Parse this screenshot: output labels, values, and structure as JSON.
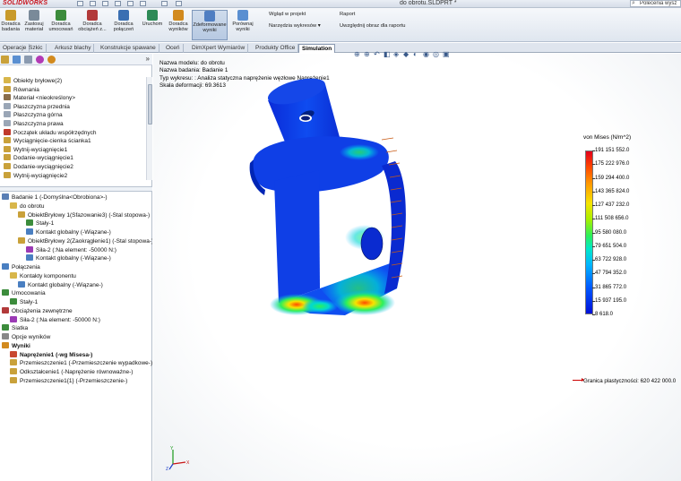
{
  "titlebar": {
    "logo": "SOLIDWORKS",
    "document_title": "do obrotu.SLDPRT *",
    "search_placeholder": "Polecenia wysz"
  },
  "ribbon": {
    "buttons": [
      {
        "label1": "Doradca",
        "label2": "badania",
        "color": "#c89a2a"
      },
      {
        "label1": "Zastosuj",
        "label2": "materiał",
        "color": "#7a8a99"
      },
      {
        "label1": "Doradca",
        "label2": "umocowań",
        "color": "#3c8c3c"
      },
      {
        "label1": "Doradca",
        "label2": "obciążeń z...",
        "color": "#b23a3a"
      },
      {
        "label1": "Doradca",
        "label2": "połączeń",
        "color": "#3a6fb2"
      },
      {
        "label1": "Uruchom",
        "label2": "",
        "color": "#2e8b57"
      },
      {
        "label1": "Doradca",
        "label2": "wyników",
        "color": "#d28a1e"
      },
      {
        "label1": "Zdeformowane",
        "label2": "wyniki",
        "color": "#4f7ec2"
      },
      {
        "label1": "Porównaj",
        "label2": "wyniki",
        "color": "#5a8fd1"
      }
    ],
    "small_items": [
      {
        "label": "Wgląd w projekt",
        "color": "#4a7fc1"
      },
      {
        "label": "Narzędzia wykresów",
        "color": "#c9472f"
      },
      {
        "label": "Raport",
        "color": "#2f6db5"
      },
      {
        "label": "Uwzględnij obraz dla raportu",
        "color": "#3a8a4a"
      }
    ]
  },
  "tabs": [
    {
      "label": "Operacje",
      "active": false
    },
    {
      "label": "Szkic",
      "active": false
    },
    {
      "label": "Arkusz blachy",
      "active": false
    },
    {
      "label": "Konstrukcje spawane",
      "active": false
    },
    {
      "label": "Oceń",
      "active": false
    },
    {
      "label": "DimXpert Wymiarów",
      "active": false
    },
    {
      "label": "Produkty Office",
      "active": false
    },
    {
      "label": "Simulation",
      "active": true
    }
  ],
  "feature_tree": {
    "items": [
      {
        "label": "Obiekty bryłowe(2)",
        "icon": "folder-icon",
        "color": "#d8b64a"
      },
      {
        "label": "Równania",
        "icon": "equation-icon",
        "color": "#c9a13a"
      },
      {
        "label": "Materiał <nieokreślony>",
        "icon": "material-icon",
        "color": "#8a6e4a"
      },
      {
        "label": "Płaszczyzna przednia",
        "icon": "plane-icon",
        "color": "#9aa6b6"
      },
      {
        "label": "Płaszczyzna górna",
        "icon": "plane-icon",
        "color": "#9aa6b6"
      },
      {
        "label": "Płaszczyzna prawa",
        "icon": "plane-icon",
        "color": "#9aa6b6"
      },
      {
        "label": "Początek układu współrzędnych",
        "icon": "origin-icon",
        "color": "#c0392b"
      },
      {
        "label": "Wyciągnięcie-cienka ścianka1",
        "icon": "extrude-icon",
        "color": "#c9a13a"
      },
      {
        "label": "Wytnij-wyciągnięcie1",
        "icon": "cut-icon",
        "color": "#c9a13a"
      },
      {
        "label": "Dodanie-wyciągnięcie1",
        "icon": "extrude-icon",
        "color": "#c9a13a"
      },
      {
        "label": "Dodanie-wyciągnięcie2",
        "icon": "extrude-icon",
        "color": "#c9a13a"
      },
      {
        "label": "Wytnij-wyciągnięcie2",
        "icon": "cut-icon",
        "color": "#c9a13a"
      }
    ]
  },
  "study_tree": {
    "items": [
      {
        "label": "Badanie 1 (-Domyślna<Obrobiona>-)",
        "indent": 0,
        "icon": "study-icon",
        "color": "#5a7fb5",
        "bold": false
      },
      {
        "label": "do obrotu",
        "indent": 1,
        "icon": "part-icon",
        "color": "#d8b64a",
        "bold": false
      },
      {
        "label": "ObiektBryłowy 1(Sfazowanie3) (-Stal stopowa-)",
        "indent": 2,
        "icon": "solid-body-icon",
        "color": "#c9a13a",
        "bold": false
      },
      {
        "label": "Stały-1",
        "indent": 3,
        "icon": "fixture-icon",
        "color": "#3c8c3c",
        "bold": false
      },
      {
        "label": "Kontakt globalny (-Wiązane-)",
        "indent": 3,
        "icon": "contact-icon",
        "color": "#4a7fc1",
        "bold": false
      },
      {
        "label": "ObiektBryłowy 2(Zaokrąglenie1) (-Stal stopowa-)",
        "indent": 2,
        "icon": "solid-body-icon",
        "color": "#c9a13a",
        "bold": false
      },
      {
        "label": "Siła-2 (:Na element: -50000 N:)",
        "indent": 3,
        "icon": "force-icon",
        "color": "#9b3ab5",
        "bold": false
      },
      {
        "label": "Kontakt globalny (-Wiązane-)",
        "indent": 3,
        "icon": "contact-icon",
        "color": "#4a7fc1",
        "bold": false
      },
      {
        "label": "Połączenia",
        "indent": 0,
        "icon": "connections-icon",
        "color": "#4a7fc1",
        "bold": false
      },
      {
        "label": "Kontakty komponentu",
        "indent": 1,
        "icon": "contacts-folder-icon",
        "color": "#d8b64a",
        "bold": false
      },
      {
        "label": "Kontakt globalny (-Wiązane-)",
        "indent": 2,
        "icon": "contact-icon",
        "color": "#4a7fc1",
        "bold": false
      },
      {
        "label": "Umocowania",
        "indent": 0,
        "icon": "fixtures-icon",
        "color": "#3c8c3c",
        "bold": false
      },
      {
        "label": "Stały-1",
        "indent": 1,
        "icon": "fixture-icon",
        "color": "#3c8c3c",
        "bold": false
      },
      {
        "label": "Obciążenia zewnętrzne",
        "indent": 0,
        "icon": "loads-icon",
        "color": "#b23a3a",
        "bold": false
      },
      {
        "label": "Siła-2 (:Na element: -50000 N:)",
        "indent": 1,
        "icon": "force-icon",
        "color": "#9b3ab5",
        "bold": false
      },
      {
        "label": "Siatka",
        "indent": 0,
        "icon": "mesh-icon",
        "color": "#3c8c3c",
        "bold": false
      },
      {
        "label": "Opcje wyników",
        "indent": 0,
        "icon": "options-icon",
        "color": "#888888",
        "bold": false
      },
      {
        "label": "Wyniki",
        "indent": 0,
        "icon": "results-icon",
        "color": "#d28a1e",
        "bold": true
      },
      {
        "label": "Naprężenie1 (-wg Misesa-)",
        "indent": 1,
        "icon": "stress-plot-icon",
        "color": "#c9472f",
        "bold": true
      },
      {
        "label": "Przemieszczenie1 (-Przemieszczenie wypadkowe-)",
        "indent": 1,
        "icon": "displacement-plot-icon",
        "color": "#c9a13a",
        "bold": false
      },
      {
        "label": "Odkształcenie1 (-Naprężenie równoważne-)",
        "indent": 1,
        "icon": "strain-plot-icon",
        "color": "#c9a13a",
        "bold": false
      },
      {
        "label": "Przemieszczenie1{1} (-Przemieszczenie-)",
        "indent": 1,
        "icon": "displacement-plot-icon",
        "color": "#c9a13a",
        "bold": false
      }
    ]
  },
  "viewport_info": {
    "model_name": "Nazwa modelu: do obrotu",
    "study_name": "Nazwa badania: Badanie 1",
    "plot_type": "Typ wykresu: : Analiza statyczna naprężenie węzłowe Naprężenie1",
    "deformation_scale": "Skala deformacji: 69.3613"
  },
  "legend": {
    "title": "von Mises (N/m^2)",
    "ticks": [
      "191 151 552.0",
      "175 222 976.0",
      "159 294 400.0",
      "143 365 824.0",
      "127 437 232.0",
      "111 508 656.0",
      "95 580 080.0",
      "79 651 504.0",
      "63 722 928.0",
      "47 794 352.0",
      "31 865 772.0",
      "15 937 195.0",
      "8 618.0"
    ],
    "yield_label": "Granica plastyczności: 620 422 000.0",
    "yield_color": "#c00000"
  },
  "triad": {
    "x": "X",
    "y": "Y",
    "z": "Z"
  }
}
